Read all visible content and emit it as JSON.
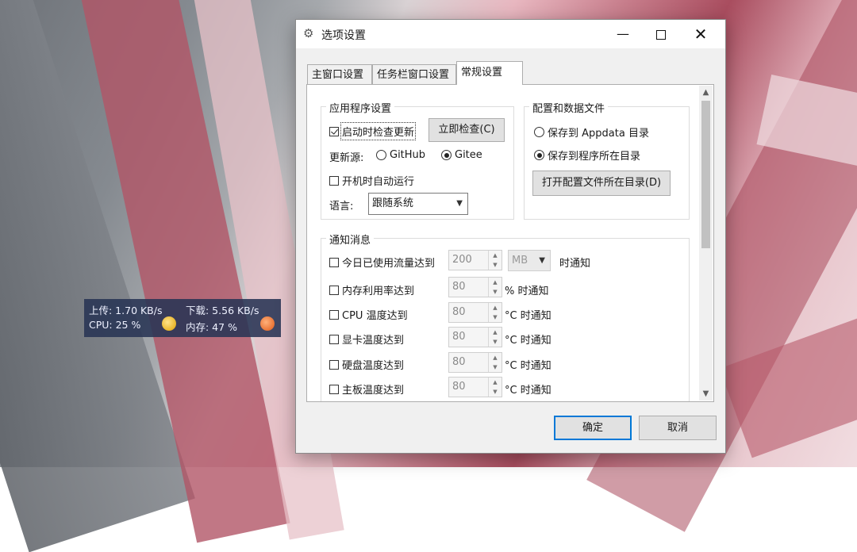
{
  "traffic_monitor": {
    "upload": "上传: 1.70 KB/s",
    "download": "下载: 5.56 KB/s",
    "cpu": "CPU: 25 %",
    "memory": "内存: 47 %"
  },
  "window": {
    "title": "选项设置",
    "icon": "gear-icon",
    "min_glyph": "—",
    "close_glyph": "✕"
  },
  "tabs": [
    {
      "label": "主窗口设置",
      "active": false
    },
    {
      "label": "任务栏窗口设置",
      "active": false
    },
    {
      "label": "常规设置",
      "active": true
    }
  ],
  "app_settings": {
    "group_title": "应用程序设置",
    "check_update_label": "启动时检查更新",
    "check_update_checked": true,
    "check_now_button": "立即检查(C)",
    "update_source_label": "更新源:",
    "source_github": "GitHub",
    "source_gitee": "Gitee",
    "selected_source": "Gitee",
    "autorun_label": "开机时自动运行",
    "autorun_checked": false,
    "language_label": "语言:",
    "language_value": "跟随系统"
  },
  "config_files": {
    "group_title": "配置和数据文件",
    "option_appdata": "保存到 Appdata 目录",
    "option_program_dir": "保存到程序所在目录",
    "selected": "option_program_dir",
    "open_dir_button": "打开配置文件所在目录(D)"
  },
  "notifications": {
    "group_title": "通知消息",
    "rows": [
      {
        "label": "今日已使用流量达到",
        "value": "200",
        "unit_select": "MB",
        "suffix": "时通知",
        "checked": false
      },
      {
        "label": "内存利用率达到",
        "value": "80",
        "suffix": "% 时通知",
        "checked": false
      },
      {
        "label": "CPU 温度达到",
        "value": "80",
        "suffix": "°C 时通知",
        "checked": false
      },
      {
        "label": "显卡温度达到",
        "value": "80",
        "suffix": "°C 时通知",
        "checked": false
      },
      {
        "label": "硬盘温度达到",
        "value": "80",
        "suffix": "°C 时通知",
        "checked": false
      },
      {
        "label": "主板温度达到",
        "value": "80",
        "suffix": "°C 时通知",
        "checked": false
      }
    ]
  },
  "footer": {
    "ok_label": "确定",
    "cancel_label": "取消"
  },
  "colors": {
    "accent": "#0078d7",
    "dialog_bg": "#f0f0f0",
    "widget_bg": "#283454"
  }
}
